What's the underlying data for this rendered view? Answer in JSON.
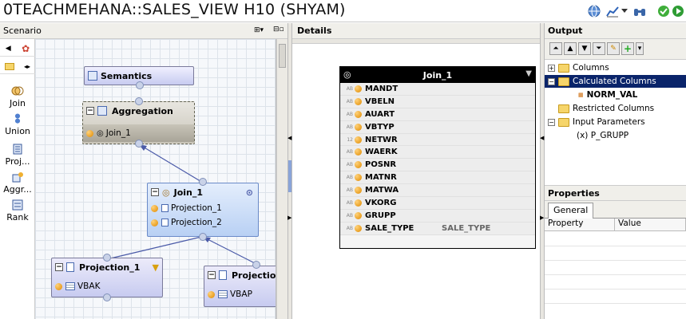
{
  "window": {
    "title": "0TEACHMEHANA::SALES_VIEW H10 (SHYAM)"
  },
  "scenario": {
    "title": "Scenario",
    "palette": [
      {
        "label": "Join"
      },
      {
        "label": "Union"
      },
      {
        "label": "Proj..."
      },
      {
        "label": "Aggr..."
      },
      {
        "label": "Rank"
      }
    ],
    "nodes": {
      "semantics": {
        "title": "Semantics"
      },
      "aggregation": {
        "title": "Aggregation",
        "input": "Join_1"
      },
      "join": {
        "title": "Join_1",
        "inputs": [
          "Projection_1",
          "Projection_2"
        ]
      },
      "projection1": {
        "title": "Projection_1",
        "input": "VBAK"
      },
      "projection2": {
        "title": "Projection",
        "input": "VBAP"
      }
    }
  },
  "details": {
    "title": "Details",
    "join_table": {
      "title": "Join_1",
      "fields": [
        {
          "type": "AB",
          "name": "MANDT",
          "alias": ""
        },
        {
          "type": "AB",
          "name": "VBELN",
          "alias": ""
        },
        {
          "type": "AB",
          "name": "AUART",
          "alias": ""
        },
        {
          "type": "AB",
          "name": "VBTYP",
          "alias": ""
        },
        {
          "type": "12",
          "name": "NETWR",
          "alias": ""
        },
        {
          "type": "AB",
          "name": "WAERK",
          "alias": ""
        },
        {
          "type": "AB",
          "name": "POSNR",
          "alias": ""
        },
        {
          "type": "AB",
          "name": "MATNR",
          "alias": ""
        },
        {
          "type": "AB",
          "name": "MATWA",
          "alias": ""
        },
        {
          "type": "AB",
          "name": "VKORG",
          "alias": ""
        },
        {
          "type": "AB",
          "name": "GRUPP",
          "alias": ""
        },
        {
          "type": "AB",
          "name": "SALE_TYPE",
          "alias": "SALE_TYPE"
        }
      ]
    }
  },
  "output": {
    "title": "Output",
    "tree": {
      "columns": "Columns",
      "calculated_columns": "Calculated Columns",
      "norm_val": "NORM_VAL",
      "restricted_columns": "Restricted Columns",
      "input_parameters": "Input Parameters",
      "p_grupp": "(x) P_GRUPP"
    }
  },
  "properties": {
    "title": "Properties",
    "tab": "General",
    "col_property": "Property",
    "col_value": "Value"
  },
  "colors": {
    "selection": "#0a246a",
    "node_fill": "#c7cbf0",
    "join_fill": "#c0d8f8",
    "aggregation_fill": "#c8c4b8"
  }
}
